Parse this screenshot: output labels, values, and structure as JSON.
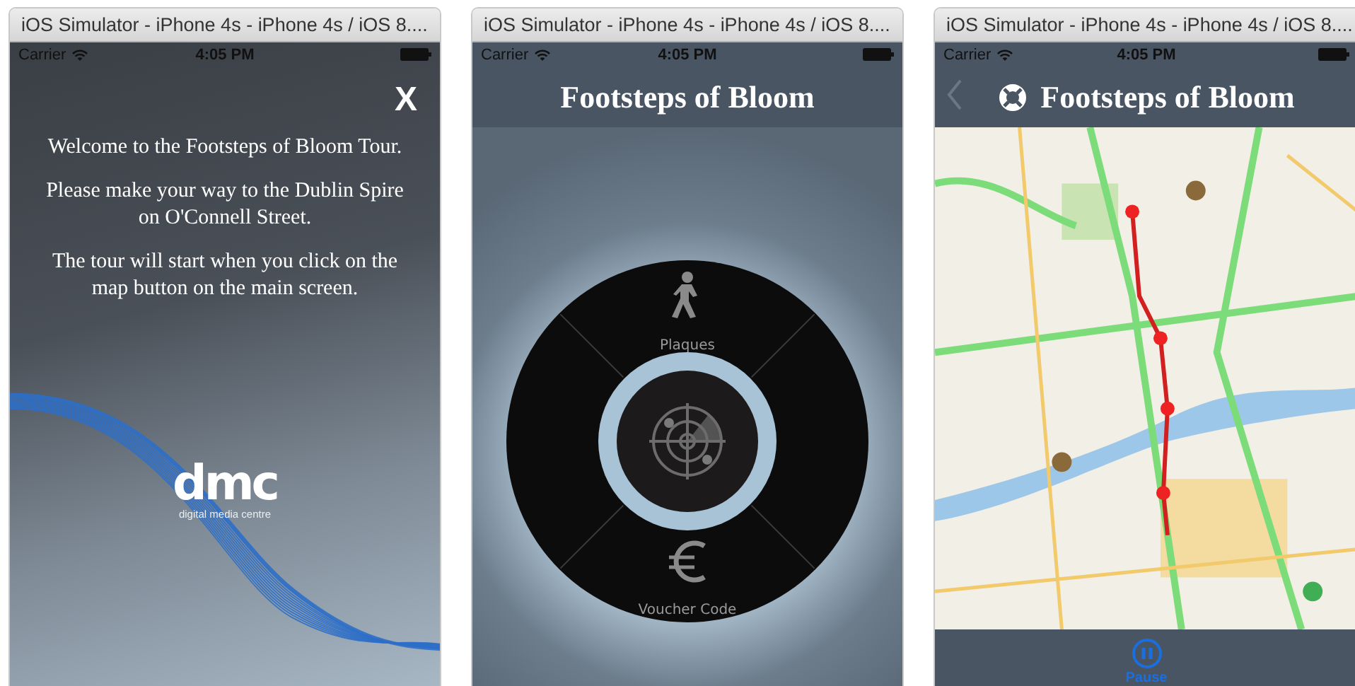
{
  "windows": [
    {
      "title": "iOS Simulator - iPhone 4s - iPhone 4s / iOS 8....",
      "status_bar": {
        "carrier": "Carrier",
        "time": "4:05 PM"
      },
      "screen": {
        "kind": "welcome",
        "close_button": "X",
        "paragraphs": [
          "Welcome to the Footsteps of Bloom Tour.",
          "Please make your way to the Dublin Spire on O'Connell Street.",
          "The tour will start when you click on the map button on the main screen."
        ],
        "logo": {
          "mark": "dmc",
          "caption": "digital media centre"
        }
      }
    },
    {
      "title": "iOS Simulator - iPhone 4s - iPhone 4s / iOS 8....",
      "status_bar": {
        "carrier": "Carrier",
        "time": "4:05 PM"
      },
      "screen": {
        "kind": "menu",
        "title": "Footsteps of Bloom",
        "items": [
          {
            "label": "Plaques",
            "kind": "walk"
          },
          {
            "label": "Voucher Code",
            "kind": "euro"
          }
        ]
      }
    },
    {
      "title": "iOS Simulator - iPhone 4s - iPhone 4s / iOS 8....",
      "status_bar": {
        "carrier": "Carrier",
        "time": "4:05 PM"
      },
      "screen": {
        "kind": "map",
        "title": "Footsteps of Bloom",
        "toolbar_button": "Pause"
      }
    }
  ]
}
